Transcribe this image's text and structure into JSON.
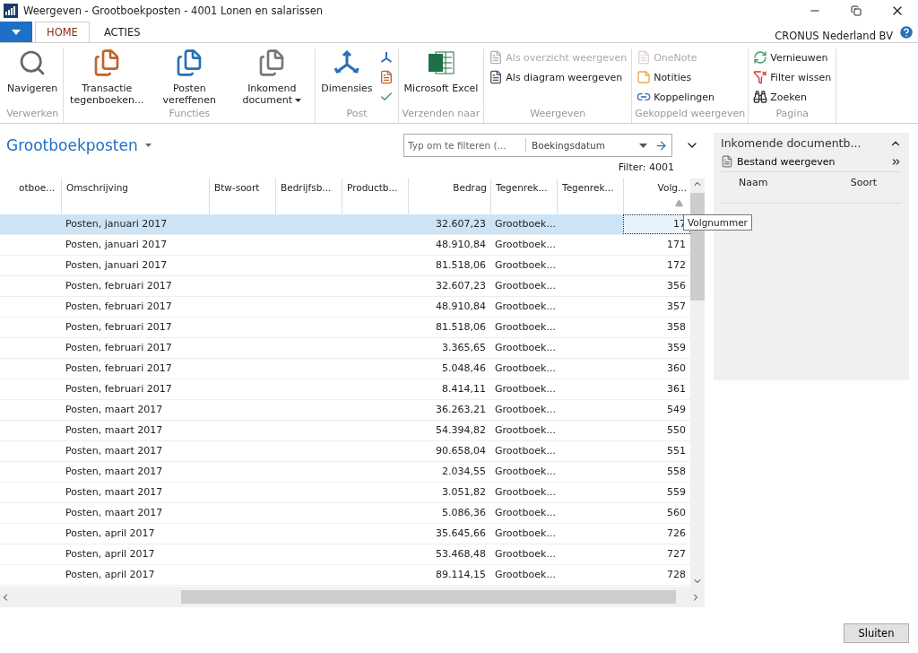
{
  "window": {
    "title": "Weergeven - Grootboekposten - 4001 Lonen en salarissen"
  },
  "tabs": [
    {
      "label": "HOME",
      "selected": true
    },
    {
      "label": "ACTIES",
      "selected": false
    }
  ],
  "company": "CRONUS Nederland BV",
  "ribbon_groups": [
    {
      "label": "Verwerken",
      "items": [
        {
          "kind": "large",
          "label": "Navigeren",
          "disabled": false
        }
      ]
    },
    {
      "label": "Functies",
      "items": [
        {
          "kind": "large",
          "label": "Transactie tegenboeken...",
          "disabled": false
        },
        {
          "kind": "large",
          "label": "Posten vereffenen",
          "disabled": false
        },
        {
          "kind": "large",
          "label": "Inkomend document",
          "dropdown": true,
          "disabled": false
        }
      ]
    },
    {
      "label": "Post",
      "items": [
        {
          "kind": "large",
          "label": "Dimensies",
          "disabled": false
        },
        {
          "kind": "iconcol"
        }
      ]
    },
    {
      "label": "Verzenden naar",
      "items": [
        {
          "kind": "large",
          "label": "Microsoft Excel",
          "disabled": false
        }
      ]
    },
    {
      "label": "Weergeven",
      "items": [
        {
          "kind": "small",
          "label": "Als overzicht weergeven",
          "disabled": true
        },
        {
          "kind": "small",
          "label": "Als diagram weergeven",
          "disabled": false
        }
      ]
    },
    {
      "label": "Gekoppeld weergeven",
      "items": [
        {
          "kind": "small",
          "label": "OneNote",
          "disabled": true
        },
        {
          "kind": "small",
          "label": "Notities",
          "disabled": false
        },
        {
          "kind": "small",
          "label": "Koppelingen",
          "disabled": false
        }
      ]
    },
    {
      "label": "Pagina",
      "items": [
        {
          "kind": "small",
          "label": "Vernieuwen",
          "disabled": false
        },
        {
          "kind": "small",
          "label": "Filter wissen",
          "disabled": false
        },
        {
          "kind": "small",
          "label": "Zoeken",
          "disabled": false
        }
      ]
    }
  ],
  "page": {
    "title": "Grootboekposten",
    "filter": {
      "placeholder": "Typ om te filteren (...",
      "field": "Boekingsdatum"
    },
    "filter_note": "Filter: 4001"
  },
  "table": {
    "columns": [
      {
        "label": "otboe...",
        "sorted": false
      },
      {
        "label": "Omschrijving",
        "sorted": false
      },
      {
        "label": "Btw-soort",
        "sorted": false
      },
      {
        "label": "Bedrijfsb...",
        "sorted": false
      },
      {
        "label": "Productb...",
        "sorted": false
      },
      {
        "label": "Bedrag",
        "sorted": false
      },
      {
        "label": "Tegenrek...",
        "sorted": false
      },
      {
        "label": "Tegenrek...",
        "sorted": false
      },
      {
        "label": "Volg...",
        "sorted": true
      }
    ],
    "rows": [
      {
        "selected": true,
        "cells": [
          "",
          "Posten, januari 2017",
          "",
          "",
          "",
          "32.607,23",
          "Grootboek...",
          "",
          "17"
        ]
      },
      {
        "selected": false,
        "cells": [
          "",
          "Posten, januari 2017",
          "",
          "",
          "",
          "48.910,84",
          "Grootboek...",
          "",
          "171"
        ]
      },
      {
        "selected": false,
        "cells": [
          "",
          "Posten, januari 2017",
          "",
          "",
          "",
          "81.518,06",
          "Grootboek...",
          "",
          "172"
        ]
      },
      {
        "selected": false,
        "cells": [
          "",
          "Posten, februari 2017",
          "",
          "",
          "",
          "32.607,23",
          "Grootboek...",
          "",
          "356"
        ]
      },
      {
        "selected": false,
        "cells": [
          "",
          "Posten, februari 2017",
          "",
          "",
          "",
          "48.910,84",
          "Grootboek...",
          "",
          "357"
        ]
      },
      {
        "selected": false,
        "cells": [
          "",
          "Posten, februari 2017",
          "",
          "",
          "",
          "81.518,06",
          "Grootboek...",
          "",
          "358"
        ]
      },
      {
        "selected": false,
        "cells": [
          "",
          "Posten, februari 2017",
          "",
          "",
          "",
          "3.365,65",
          "Grootboek...",
          "",
          "359"
        ]
      },
      {
        "selected": false,
        "cells": [
          "",
          "Posten, februari 2017",
          "",
          "",
          "",
          "5.048,46",
          "Grootboek...",
          "",
          "360"
        ]
      },
      {
        "selected": false,
        "cells": [
          "",
          "Posten, februari 2017",
          "",
          "",
          "",
          "8.414,11",
          "Grootboek...",
          "",
          "361"
        ]
      },
      {
        "selected": false,
        "cells": [
          "",
          "Posten, maart 2017",
          "",
          "",
          "",
          "36.263,21",
          "Grootboek...",
          "",
          "549"
        ]
      },
      {
        "selected": false,
        "cells": [
          "",
          "Posten, maart 2017",
          "",
          "",
          "",
          "54.394,82",
          "Grootboek...",
          "",
          "550"
        ]
      },
      {
        "selected": false,
        "cells": [
          "",
          "Posten, maart 2017",
          "",
          "",
          "",
          "90.658,04",
          "Grootboek...",
          "",
          "551"
        ]
      },
      {
        "selected": false,
        "cells": [
          "",
          "Posten, maart 2017",
          "",
          "",
          "",
          "2.034,55",
          "Grootboek...",
          "",
          "558"
        ]
      },
      {
        "selected": false,
        "cells": [
          "",
          "Posten, maart 2017",
          "",
          "",
          "",
          "3.051,82",
          "Grootboek...",
          "",
          "559"
        ]
      },
      {
        "selected": false,
        "cells": [
          "",
          "Posten, maart 2017",
          "",
          "",
          "",
          "5.086,36",
          "Grootboek...",
          "",
          "560"
        ]
      },
      {
        "selected": false,
        "cells": [
          "",
          "Posten, april 2017",
          "",
          "",
          "",
          "35.645,66",
          "Grootboek...",
          "",
          "726"
        ]
      },
      {
        "selected": false,
        "cells": [
          "",
          "Posten, april 2017",
          "",
          "",
          "",
          "53.468,48",
          "Grootboek...",
          "",
          "727"
        ]
      },
      {
        "selected": false,
        "cells": [
          "",
          "Posten, april 2017",
          "",
          "",
          "",
          "89.114,15",
          "Grootboek...",
          "",
          "728"
        ]
      }
    ]
  },
  "tooltip": "Volgnummer",
  "factbox": {
    "title": "Inkomende documentb...",
    "action": "Bestand weergeven",
    "columns": [
      "Naam",
      "Soort"
    ]
  },
  "buttons": [
    "Sluiten"
  ]
}
